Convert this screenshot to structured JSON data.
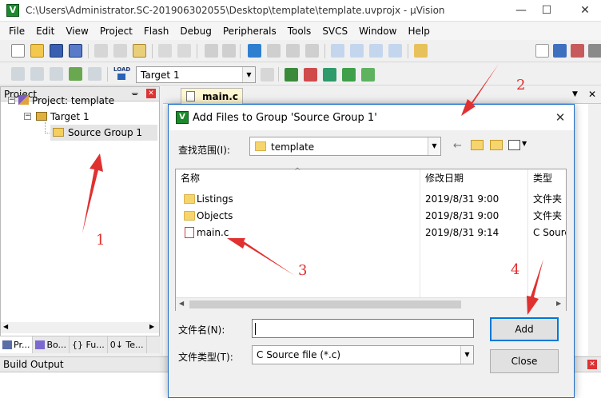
{
  "window": {
    "title": "C:\\Users\\Administrator.SC-201906302055\\Desktop\\template\\template.uvprojx - µVision",
    "minimize": "—",
    "maximize": "☐",
    "close": "✕"
  },
  "menu": [
    "File",
    "Edit",
    "View",
    "Project",
    "Flash",
    "Debug",
    "Peripherals",
    "Tools",
    "SVCS",
    "Window",
    "Help"
  ],
  "toolbar2": {
    "load_label": "LOAD",
    "target_select": "Target 1"
  },
  "project_pane": {
    "title": "Project",
    "pin": "ᚚ",
    "close": "✕",
    "tree": {
      "root": "Project: template",
      "target": "Target 1",
      "group": "Source Group 1"
    },
    "tabs": [
      "Pr...",
      "Bo...",
      "{} Fu...",
      "0↓ Te..."
    ]
  },
  "editor": {
    "tab": "main.c"
  },
  "build_output": {
    "title": "Build Output"
  },
  "dialog": {
    "title": "Add Files to Group 'Source Group 1'",
    "look_in_label": "查找范围(I):",
    "look_in_value": "template",
    "columns": [
      "名称",
      "修改日期",
      "类型"
    ],
    "files": [
      {
        "name": "Listings",
        "date": "2019/8/31 9:00",
        "type": "文件夹",
        "kind": "folder"
      },
      {
        "name": "Objects",
        "date": "2019/8/31 9:00",
        "type": "文件夹",
        "kind": "folder"
      },
      {
        "name": "main.c",
        "date": "2019/8/31 9:14",
        "type": "C Sourc",
        "kind": "c-file"
      }
    ],
    "filename_label": "文件名(N):",
    "filename_value": "",
    "filetype_label": "文件类型(T):",
    "filetype_value": "C Source file (*.c)",
    "add_button": "Add",
    "close_button": "Close"
  },
  "annotations": [
    "1",
    "2",
    "3",
    "4"
  ],
  "colors": {
    "annotation": "#e03030",
    "dialog_border": "#1e6fc8",
    "tab_active": "#fff7d0"
  }
}
